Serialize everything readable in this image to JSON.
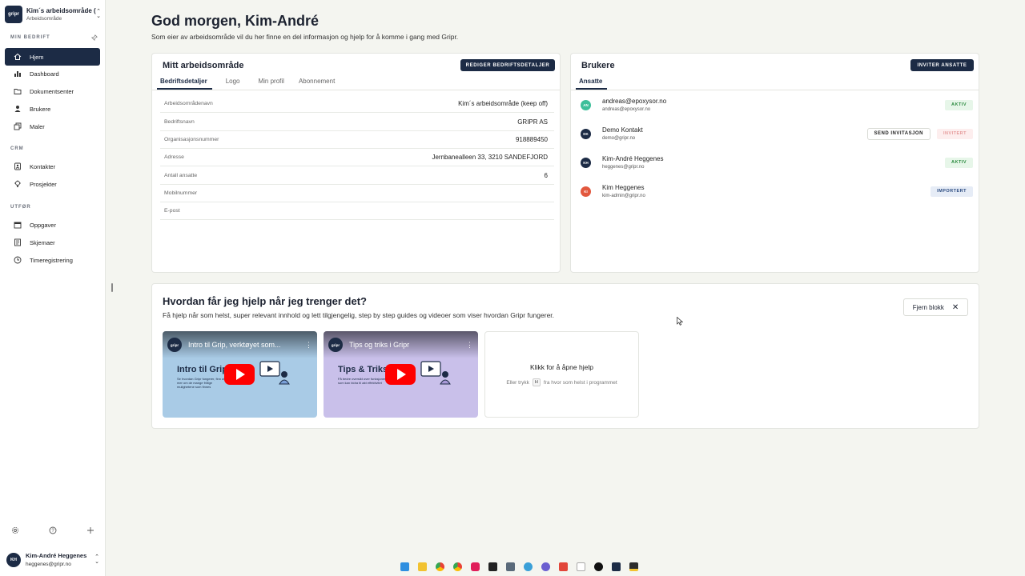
{
  "workspace": {
    "logo": "gripr",
    "name": "Kim´s arbeidsområde (keep off)",
    "subtitle": "Arbeidsområde"
  },
  "sidebar": {
    "sections": [
      {
        "title": "MIN BEDRIFT",
        "items": [
          {
            "label": "Hjem",
            "icon": "home-icon",
            "active": true
          },
          {
            "label": "Dashboard",
            "icon": "bar-chart-icon"
          },
          {
            "label": "Dokumentsenter",
            "icon": "folder-icon"
          },
          {
            "label": "Brukere",
            "icon": "user-icon"
          },
          {
            "label": "Maler",
            "icon": "template-icon"
          }
        ]
      },
      {
        "title": "CRM",
        "items": [
          {
            "label": "Kontakter",
            "icon": "contacts-icon"
          },
          {
            "label": "Prosjekter",
            "icon": "lightbulb-icon"
          }
        ]
      },
      {
        "title": "UTFØR",
        "items": [
          {
            "label": "Oppgaver",
            "icon": "calendar-icon"
          },
          {
            "label": "Skjemaer",
            "icon": "form-icon"
          },
          {
            "label": "Timeregistrering",
            "icon": "clock-icon"
          }
        ]
      }
    ],
    "bottom_icons": [
      "settings-icon",
      "help-icon",
      "plus-icon"
    ],
    "user": {
      "initials": "KH",
      "name": "Kim-André Heggenes",
      "email": "heggenes@gripr.no"
    }
  },
  "main": {
    "greeting": "God morgen, Kim-André",
    "intro": "Som eier av arbeidsområde vil du her finne en del informasjon og hjelp for å komme i gang med Gripr."
  },
  "workspace_card": {
    "title": "Mitt arbeidsområde",
    "edit_button": "REDIGER BEDRIFTSDETALJER",
    "tabs": [
      "Bedriftsdetaljer",
      "Logo",
      "Min profil",
      "Abonnement"
    ],
    "rows": [
      {
        "key": "Arbeidsområdenavn",
        "value": "Kim´s arbeidsområde (keep off)"
      },
      {
        "key": "Bedriftsnavn",
        "value": "GRIPR AS"
      },
      {
        "key": "Organisasjonsnummer",
        "value": "918889450"
      },
      {
        "key": "Adresse",
        "value": "Jernbanealleen 33, 3210 SANDEFJORD"
      },
      {
        "key": "Antall ansatte",
        "value": "6"
      },
      {
        "key": "Mobilnummer",
        "value": ""
      },
      {
        "key": "E-post",
        "value": ""
      }
    ]
  },
  "users_card": {
    "title": "Brukere",
    "invite_button": "INVITER ANSATTE",
    "tab": "Ansatte",
    "users": [
      {
        "initials": "AN",
        "color": "#3dbf9a",
        "name": "andreas@epoxysor.no",
        "email": "andreas@epoxysor.no",
        "status": "AKTIV",
        "status_type": "aktiv",
        "action": ""
      },
      {
        "initials": "DK",
        "color": "#1c2b45",
        "name": "Demo Kontakt",
        "email": "demo@gripr.no",
        "status": "INVITERT",
        "status_type": "invitert",
        "action": "SEND INVITASJON"
      },
      {
        "initials": "KH",
        "color": "#1c2b45",
        "name": "Kim-André Heggenes",
        "email": "heggenes@gripr.no",
        "status": "AKTIV",
        "status_type": "aktiv",
        "action": ""
      },
      {
        "initials": "KI",
        "color": "#e2583e",
        "name": "Kim Heggenes",
        "email": "kim-admin@gripr.no",
        "status": "IMPORTERT",
        "status_type": "import",
        "action": ""
      }
    ]
  },
  "help": {
    "title": "Hvordan får jeg hjelp når jeg trenger det?",
    "subtitle": "Få hjelp når som helst, super relevant innhold og lett tilgjengelig, step by step guides og videoer som viser hvordan Gripr fungerer.",
    "remove_button": "Fjern blokk",
    "videos": [
      {
        "channel": "gripr",
        "title": "Intro til Grip, verktøyet som...",
        "big": "Intro til Grip",
        "small": "Se hvordan Gripr fungerer, finn ut mer om de mange frillige mulighetene som finnes",
        "bg": "#a9cbe6"
      },
      {
        "channel": "gripr",
        "title": "Tips og triks i Gripr",
        "big": "Tips & Triks",
        "small": "Få bedre oversikt over funksjoner som kan bidra til økt effektivitet",
        "bg": "#c9c0ea"
      }
    ],
    "open_help": {
      "title": "Klikk for å åpne hjelp",
      "pre": "Eller trykk",
      "key": "H",
      "post": "fra hvor som helst i programmet"
    }
  },
  "taskbar_icons": [
    "windows-icon",
    "explorer-icon",
    "chrome-icon",
    "chrome-icon",
    "slack-icon",
    "app-icon",
    "calculator-icon",
    "app-icon",
    "app-icon",
    "app-icon",
    "app-icon",
    "chatgpt-icon",
    "app-icon",
    "app-icon"
  ]
}
